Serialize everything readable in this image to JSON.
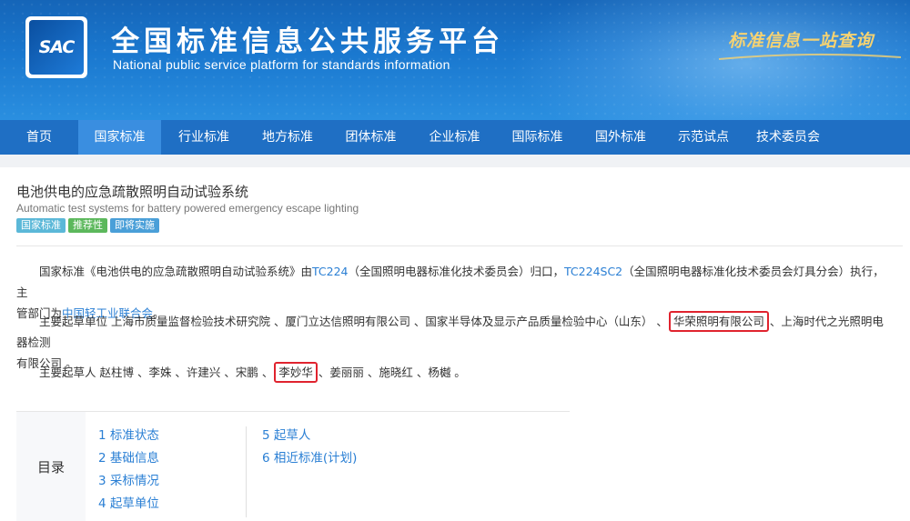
{
  "header": {
    "logo_text": "SAC",
    "title": "全国标准信息公共服务平台",
    "subtitle": "National public service platform  for standards information",
    "slogan": "标准信息一站查询"
  },
  "nav": {
    "items": [
      {
        "label": "首页",
        "active": false
      },
      {
        "label": "国家标准",
        "active": true
      },
      {
        "label": "行业标准",
        "active": false
      },
      {
        "label": "地方标准",
        "active": false
      },
      {
        "label": "团体标准",
        "active": false
      },
      {
        "label": "企业标准",
        "active": false
      },
      {
        "label": "国际标准",
        "active": false
      },
      {
        "label": "国外标准",
        "active": false
      },
      {
        "label": "示范试点",
        "active": false
      },
      {
        "label": "技术委员会",
        "active": false
      }
    ]
  },
  "standard": {
    "title": "电池供电的应急疏散照明自动试验系统",
    "english_title": "Automatic test systems for battery powered emergency escape lighting",
    "tags": [
      {
        "label": "国家标准",
        "color": "#5bb8d8"
      },
      {
        "label": "推荐性",
        "color": "#5cb85c"
      },
      {
        "label": "即将实施",
        "color": "#4a9fd8"
      }
    ]
  },
  "description": {
    "p1_a": "国家标准《电池供电的应急疏散照明自动试验系统》由",
    "p1_link1": "TC224",
    "p1_b": "（全国照明电器标准化技术委员会）归口，",
    "p1_link2": "TC224SC2",
    "p1_c": "（全国照明电器标准化技术委员会灯具分会）执行，主",
    "p1_d": "管部门为",
    "p1_link3": "中国轻工业联合会",
    "p1_e": "。",
    "p2_a": "主要起草单位 上海市质量监督检验技术研究院 、厦门立达信照明有限公司 、国家半导体及显示产品质量检验中心（山东） 、",
    "p2_hl": "华荣照明有限公司",
    "p2_b": "、上海时代之光照明电器检测",
    "p2_c": "有限公司 。",
    "p3_a": "主要起草人 赵柱博 、李姝 、许建兴 、宋鹏 、",
    "p3_hl": "李妙华",
    "p3_b": "、姜丽丽 、施晓红 、杨樾 。",
    "highlight_color": "#e0232e"
  },
  "toc": {
    "label": "目录",
    "left": [
      "1  标准状态",
      "2  基础信息",
      "3  采标情况",
      "4  起草单位"
    ],
    "right": [
      "5  起草人",
      "6  相近标准(计划)"
    ]
  }
}
